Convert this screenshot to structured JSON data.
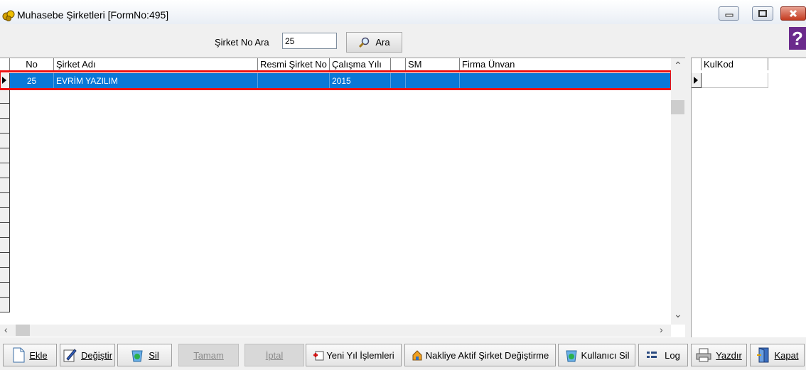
{
  "window": {
    "title": "Muhasebe Şirketleri [FormNo:495]"
  },
  "search": {
    "label": "Şirket No Ara",
    "value": "25",
    "button_label": "Ara"
  },
  "grid": {
    "columns": [
      "No",
      "Şirket Adı",
      "Resmi Şirket No",
      "Çalışma Yılı",
      "",
      "SM",
      "Firma Ünvan"
    ],
    "rows": [
      {
        "no": "25",
        "sirket_adi": "EVRİM YAZILIM",
        "resmi_no": "",
        "calisma_yili": "2015",
        "extra": "",
        "sm": "",
        "firma_unvan": ""
      }
    ],
    "selected_row_color": "#0a78d7",
    "highlight_color": "#ee1111"
  },
  "side_grid": {
    "columns": [
      "KulKod"
    ]
  },
  "toolbar": {
    "ekle": "Ekle",
    "degistir": "Değiştir",
    "sil": "Sil",
    "tamam": "Tamam",
    "iptal": "İptal",
    "yeni_yil": "Yeni Yıl İşlemleri",
    "nakliye": "Nakliye Aktif Şirket Değiştirme",
    "kullanici_sil": "Kullanıcı Sil",
    "log": "Log",
    "yazdir": "Yazdır",
    "kapat": "Kapat"
  }
}
